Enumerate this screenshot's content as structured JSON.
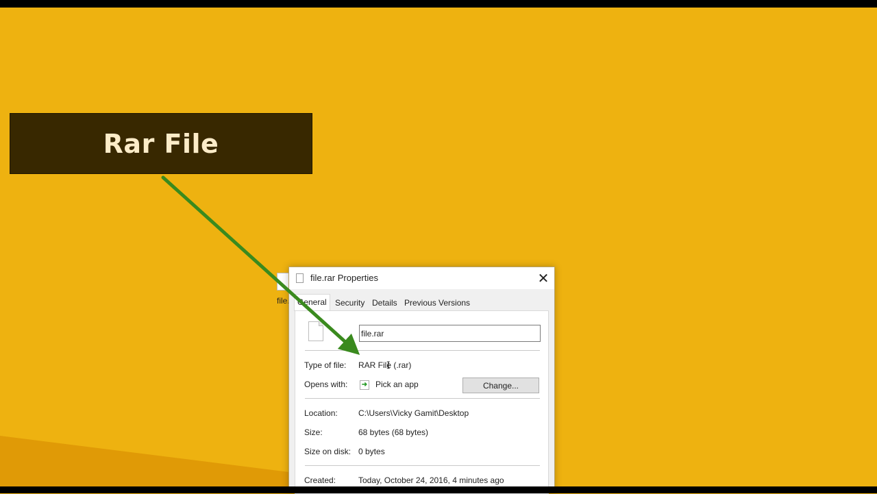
{
  "colors": {
    "background": "#eeb210",
    "callout_bg": "#382800",
    "callout_text": "#fcecc8",
    "arrow": "#3a8a1e",
    "dialog_bg": "#f0f0f0"
  },
  "callout": {
    "text": "Rar File"
  },
  "desktop_item": {
    "label": "file.rar"
  },
  "dialog": {
    "title": "file.rar Properties",
    "close_glyph": "✕",
    "tabs": [
      "General",
      "Security",
      "Details",
      "Previous Versions"
    ],
    "active_tab": "General",
    "file_name": "file.rar",
    "type_label": "Type of file:",
    "type_value": "RAR File (.rar)",
    "opens_label": "Opens with:",
    "opens_value": "Pick an app",
    "change_button": "Change...",
    "location_label": "Location:",
    "location_value": "C:\\Users\\Vicky Gamit\\Desktop",
    "size_label": "Size:",
    "size_value": "68 bytes (68 bytes)",
    "size_on_disk_label": "Size on disk:",
    "size_on_disk_value": "0 bytes",
    "created_label": "Created:",
    "created_value": "Today, October 24, 2016, 4 minutes ago"
  },
  "icons": {
    "close": "close-icon",
    "file": "file-icon",
    "app": "pick-app-icon"
  }
}
